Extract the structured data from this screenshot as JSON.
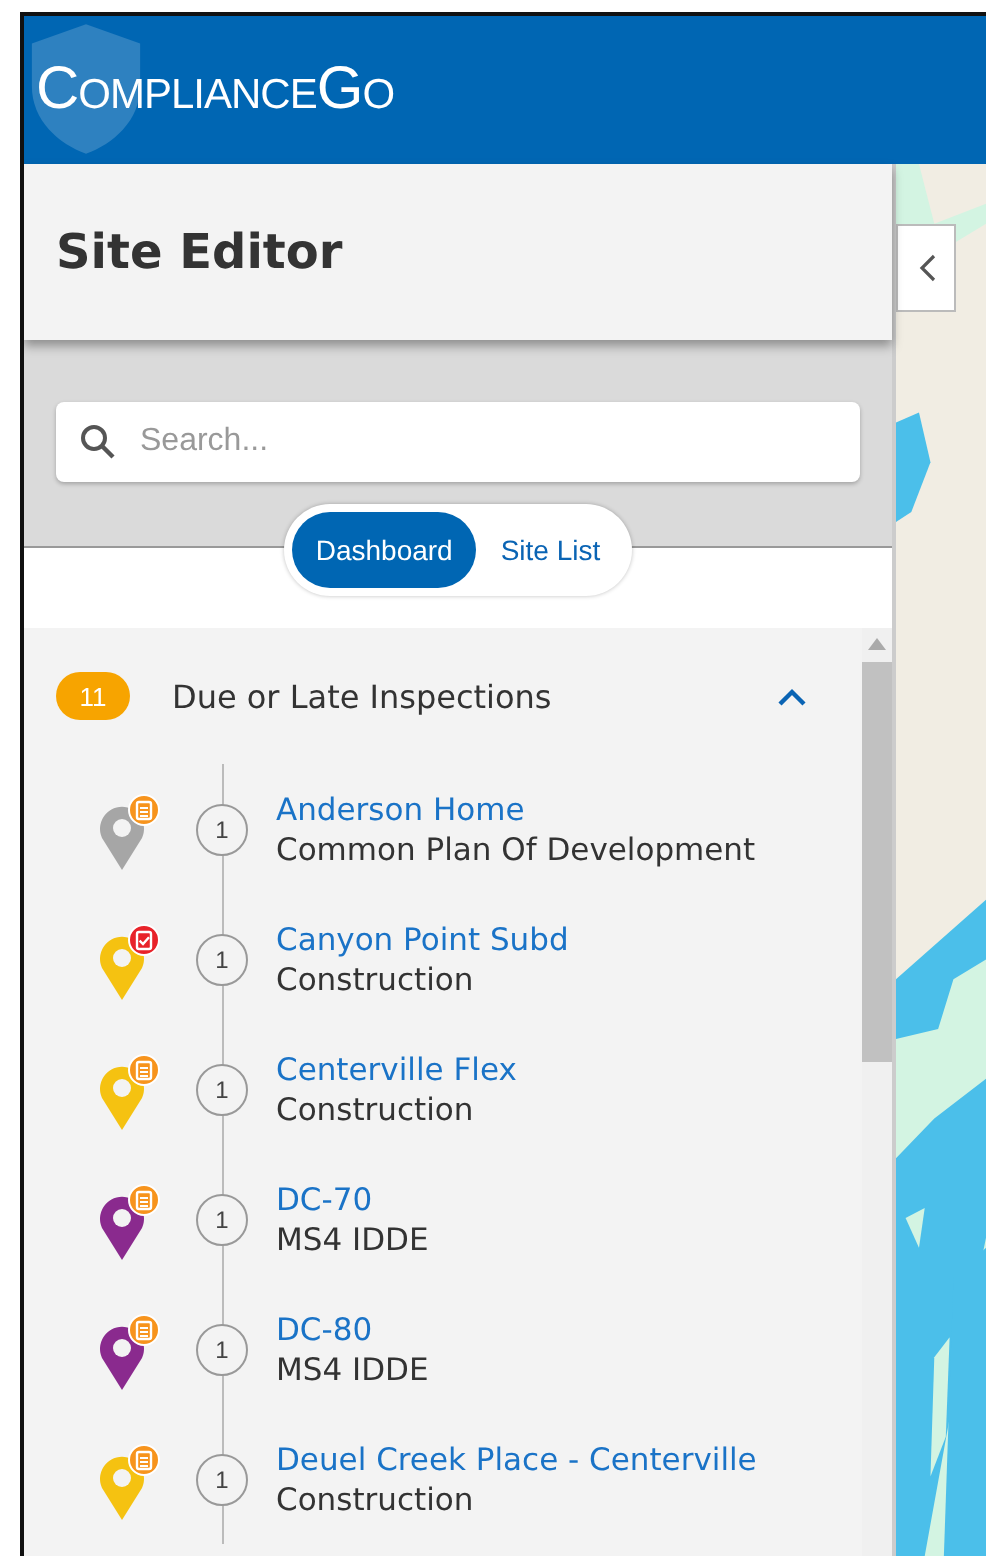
{
  "header": {
    "logo": "ComplianceGo"
  },
  "panel": {
    "title": "Site Editor",
    "search": {
      "placeholder": "Search..."
    },
    "view_tabs": [
      {
        "label": "Dashboard",
        "selected": true
      },
      {
        "label": "Site List",
        "selected": false
      }
    ],
    "section": {
      "count": "11",
      "title": "Due or Late Inspections",
      "expanded": true,
      "sites": [
        {
          "name": "Anderson Home",
          "type": "Common Plan Of Development",
          "count": "1",
          "color": "#a6a6a6",
          "kind": "clipboard"
        },
        {
          "name": "Canyon Point Subd",
          "type": "Construction",
          "count": "1",
          "color": "#f5c211",
          "kind": "checked"
        },
        {
          "name": "Centerville Flex",
          "type": "Construction",
          "count": "1",
          "color": "#f5c211",
          "kind": "clipboard"
        },
        {
          "name": "DC-70",
          "type": "MS4 IDDE",
          "count": "1",
          "color": "#8a2a8e",
          "kind": "clipboard"
        },
        {
          "name": "DC-80",
          "type": "MS4 IDDE",
          "count": "1",
          "color": "#8a2a8e",
          "kind": "clipboard"
        },
        {
          "name": "Deuel Creek Place - Centerville",
          "type": "Construction",
          "count": "1",
          "color": "#f5c211",
          "kind": "clipboard"
        }
      ]
    }
  }
}
